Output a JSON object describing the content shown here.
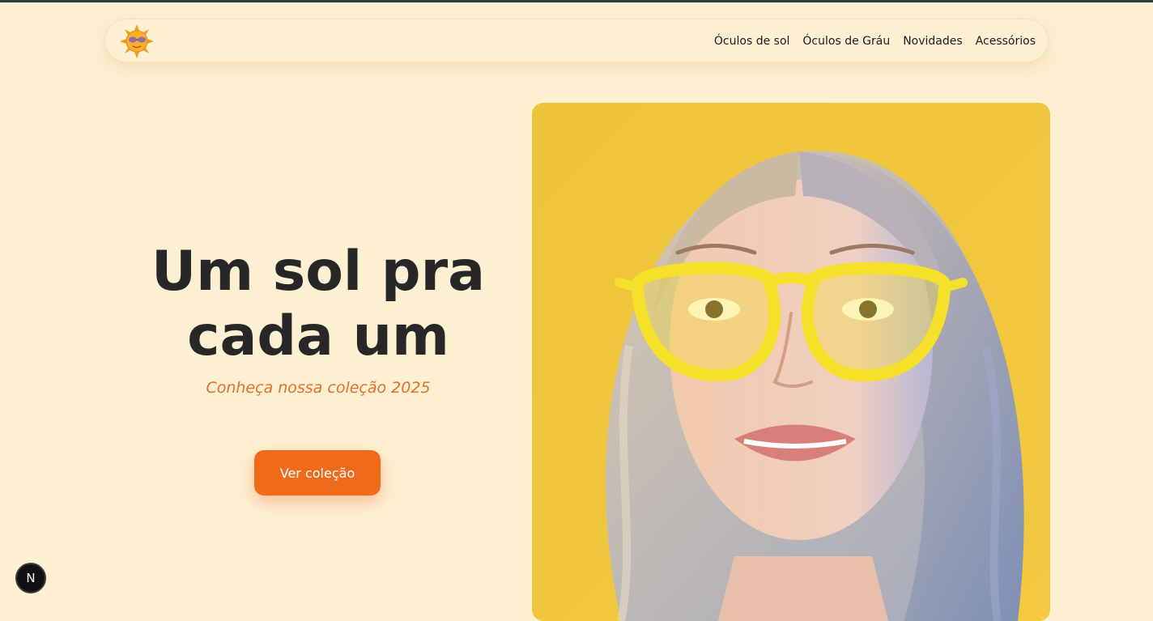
{
  "nav": {
    "logo_icon": "sun-with-sunglasses-icon",
    "items": [
      {
        "label": "Óculos de sol"
      },
      {
        "label": "Óculos de Gráu"
      },
      {
        "label": "Novidades"
      },
      {
        "label": "Acessórios"
      }
    ]
  },
  "hero": {
    "title_line1": "Um sol pra",
    "title_line2": "cada um",
    "subtitle": "Conheça nossa coleção 2025",
    "cta_label": "Ver coleção",
    "image_icon": "woman-with-yellow-glasses-image"
  },
  "dev_badge": {
    "label": "N",
    "icon": "nextjs-icon"
  },
  "colors": {
    "background": "#fdefd2",
    "accent": "#f06a1c",
    "subtitle": "#e0712a",
    "heading": "#272727",
    "image_background": "#f2c63c",
    "glasses": "#f5e02a"
  }
}
